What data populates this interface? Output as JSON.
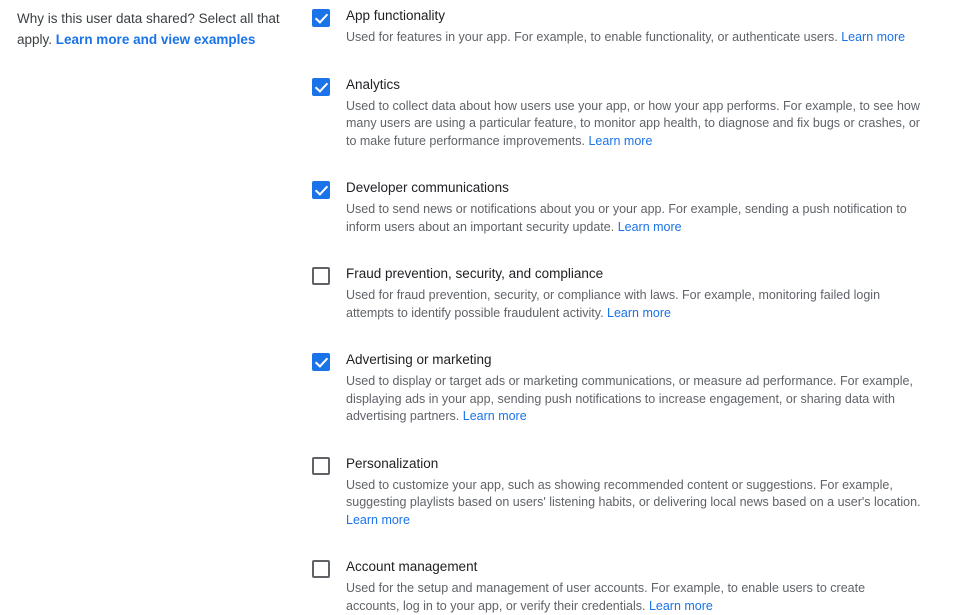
{
  "prompt": {
    "question": "Why is this user data shared? Select all that apply.",
    "link_label": "Learn more and view examples"
  },
  "common": {
    "learn_more_label": "Learn more"
  },
  "options": [
    {
      "id": "app-functionality",
      "label": "App functionality",
      "checked": true,
      "checkbox_state": "checked",
      "description": "Used for features in your app. For example, to enable functionality, or authenticate users.",
      "learn_more_label": "Learn more"
    },
    {
      "id": "analytics",
      "label": "Analytics",
      "checked": true,
      "checkbox_state": "checked",
      "description": "Used to collect data about how users use your app, or how your app performs. For example, to see how many users are using a particular feature, to monitor app health, to diagnose and fix bugs or crashes, or to make future performance improvements.",
      "learn_more_label": "Learn more"
    },
    {
      "id": "developer-communications",
      "label": "Developer communications",
      "checked": true,
      "checkbox_state": "checked",
      "description": "Used to send news or notifications about you or your app. For example, sending a push notification to inform users about an important security update.",
      "learn_more_label": "Learn more"
    },
    {
      "id": "fraud-prevention-security-and-compliance",
      "label": "Fraud prevention, security, and compliance",
      "checked": false,
      "checkbox_state": "unchecked",
      "description": "Used for fraud prevention, security, or compliance with laws. For example, monitoring failed login attempts to identify possible fraudulent activity.",
      "learn_more_label": "Learn more"
    },
    {
      "id": "advertising-or-marketing",
      "label": "Advertising or marketing",
      "checked": true,
      "checkbox_state": "checked",
      "description": "Used to display or target ads or marketing communications, or measure ad performance. For example, displaying ads in your app, sending push notifications to increase engagement, or sharing data with advertising partners.",
      "learn_more_label": "Learn more"
    },
    {
      "id": "personalization",
      "label": "Personalization",
      "checked": false,
      "checkbox_state": "unchecked",
      "description": "Used to customize your app, such as showing recommended content or suggestions. For example, suggesting playlists based on users' listening habits, or delivering local news based on a user's location.",
      "learn_more_label": "Learn more"
    },
    {
      "id": "account-management",
      "label": "Account management",
      "checked": false,
      "checkbox_state": "unchecked",
      "description": "Used for the setup and management of user accounts. For example, to enable users to create accounts, log in to your app, or verify their credentials.",
      "learn_more_label": "Learn more"
    }
  ],
  "colors": {
    "accent_blue": "#1a73e8",
    "title_text": "#202124",
    "body_text": "#5f6368",
    "checkbox_border": "#5f6368",
    "background": "#ffffff"
  }
}
